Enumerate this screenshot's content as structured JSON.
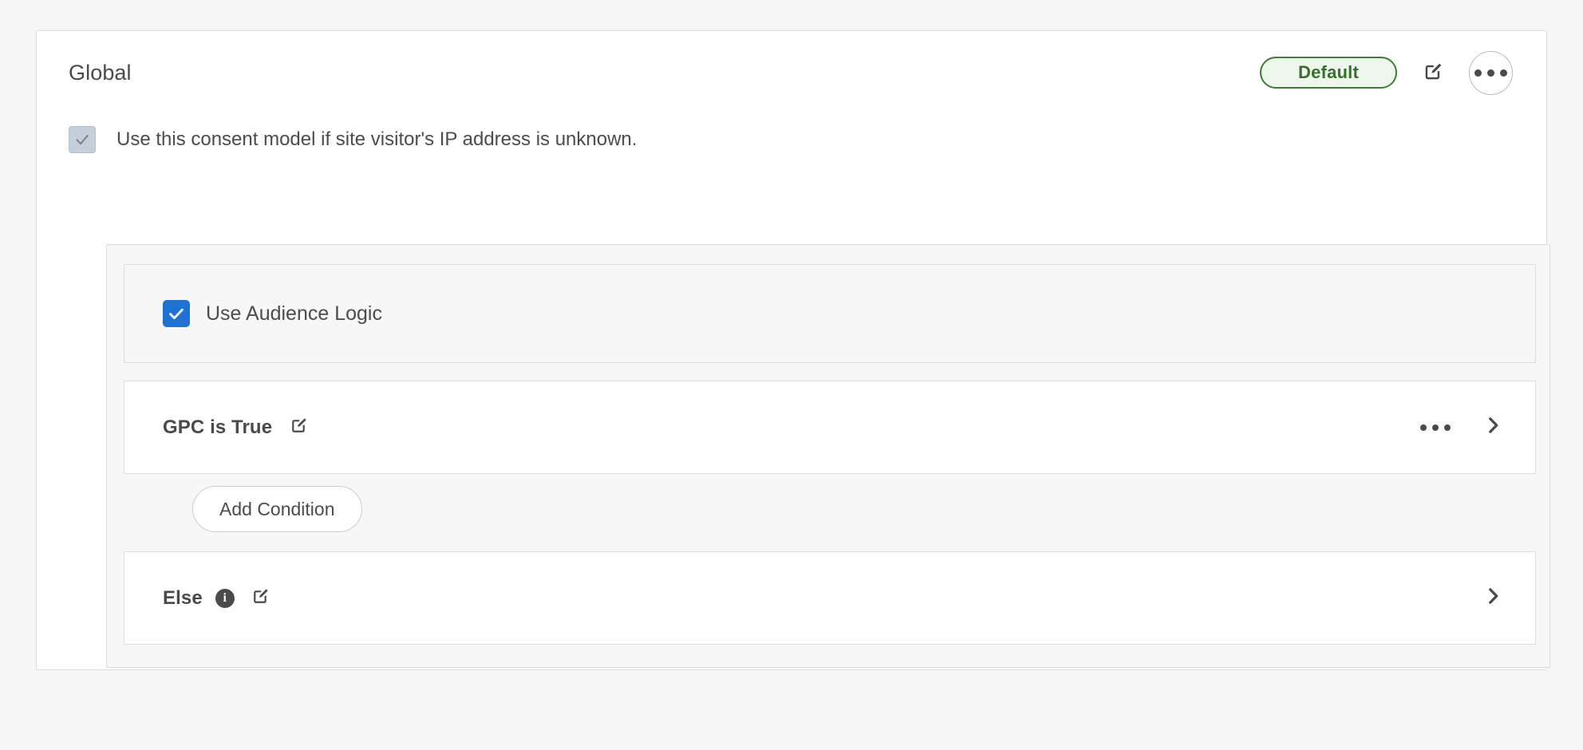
{
  "card": {
    "title": "Global",
    "badge_label": "Default",
    "badge_border_color": "#3f7c35",
    "badge_bg_color": "#edf7ec",
    "badge_text_color": "#35702b",
    "edit_icon": "edit-pencil-square-icon",
    "overflow_icon": "ellipsis-horizontal-icon"
  },
  "consent": {
    "checkbox_state": "checked-disabled",
    "checkbox_fill": "#c3cfd9",
    "label": "Use this consent model if site visitor's IP address is unknown."
  },
  "audience": {
    "checkbox_state": "checked",
    "checkbox_fill": "#1f72d3",
    "label": "Use Audience Logic"
  },
  "rules": [
    {
      "title": "GPC is True",
      "edit_icon": "edit-pencil-square-icon",
      "has_info_icon": false,
      "has_overflow": true,
      "overflow_icon": "ellipsis-horizontal-icon",
      "chevron_icon": "chevron-right-icon"
    },
    {
      "title": "Else",
      "edit_icon": "edit-pencil-square-icon",
      "has_info_icon": true,
      "info_icon": "info-circle-icon",
      "info_glyph": "i",
      "has_overflow": false,
      "chevron_icon": "chevron-right-icon"
    }
  ],
  "actions": {
    "add_condition_label": "Add Condition"
  }
}
